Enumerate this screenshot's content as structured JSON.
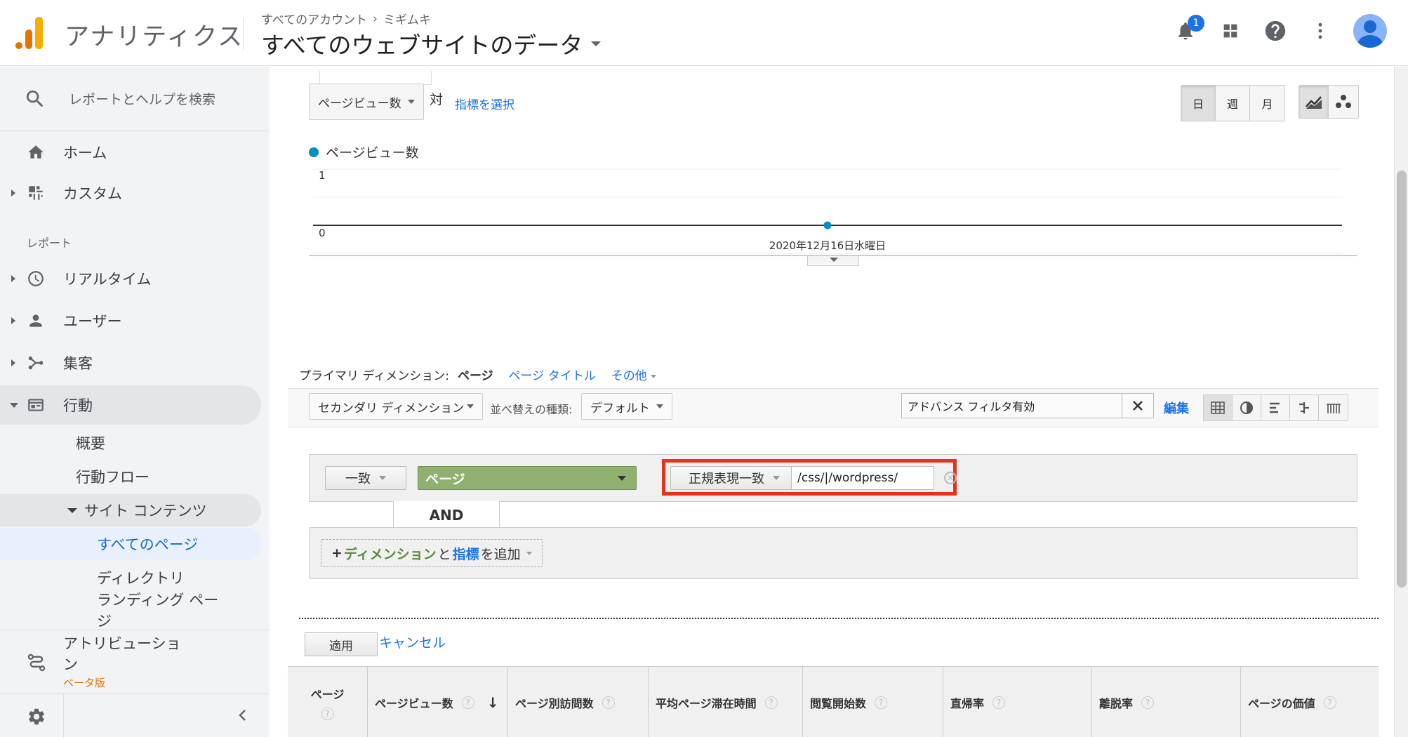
{
  "header": {
    "app_name": "アナリティクス",
    "breadcrumb_account": "すべてのアカウント",
    "breadcrumb_sep": "›",
    "breadcrumb_property": "ミギムキ",
    "view_title": "すべてのウェブサイトのデータ",
    "notification_count": "1"
  },
  "sidebar": {
    "search_placeholder": "レポートとヘルプを検索",
    "home": "ホーム",
    "custom": "カスタム",
    "section_reports": "レポート",
    "realtime": "リアルタイム",
    "users": "ユーザー",
    "acquisition": "集客",
    "behavior": "行動",
    "overview": "概要",
    "behavior_flow": "行動フロー",
    "site_content": "サイト コンテンツ",
    "all_pages": "すべてのページ",
    "directory": "ディレクトリ",
    "landing_page": "ランディング ペー",
    "landing_page_wrap": "ジ",
    "attribution_line1": "アトリビューショ",
    "attribution_line2": "ン",
    "attribution_beta": "ベータ版"
  },
  "chart_controls": {
    "metric_select": "ページビュー数",
    "versus": "対",
    "choose_metric": "指標を選択",
    "day": "日",
    "week": "週",
    "month": "月"
  },
  "chart_data": {
    "type": "line",
    "series": [
      {
        "name": "ページビュー数",
        "color": "#058dc7",
        "values": [
          0
        ]
      }
    ],
    "x": [
      "2020年12月16日水曜日"
    ],
    "ylim": [
      0,
      1
    ],
    "ytick_labels": [
      "1",
      "0"
    ],
    "xlabel": "",
    "ylabel": "",
    "title": "",
    "grid": true
  },
  "dimension_row": {
    "label": "プライマリ ディメンション:",
    "current": "ページ",
    "page_title": "ページ タイトル",
    "other": "その他"
  },
  "toolbar": {
    "secondary_dimension": "セカンダリ ディメンション",
    "sort_label": "並べ替えの種類:",
    "sort_value": "デフォルト",
    "filter_text": "アドバンス フィルタ有効",
    "edit": "編集"
  },
  "advanced_filter": {
    "include": "一致",
    "dimension": "ページ",
    "match_type": "正規表現一致",
    "value": "/css/|/wordpress/",
    "and_label": "AND",
    "add_plus": "+",
    "add_dimension": "ディメンション",
    "add_and": "と",
    "add_metric": "指標",
    "add_suffix": "を追加",
    "apply": "適用",
    "cancel": "キャンセル"
  },
  "table": {
    "columns": [
      "ページ",
      "ページビュー数",
      "ページ別訪問数",
      "平均ページ滞在時間",
      "閲覧開始数",
      "直帰率",
      "離脱率",
      "ページの価値"
    ],
    "help_glyph": "?",
    "sort_arrow": "↓"
  }
}
